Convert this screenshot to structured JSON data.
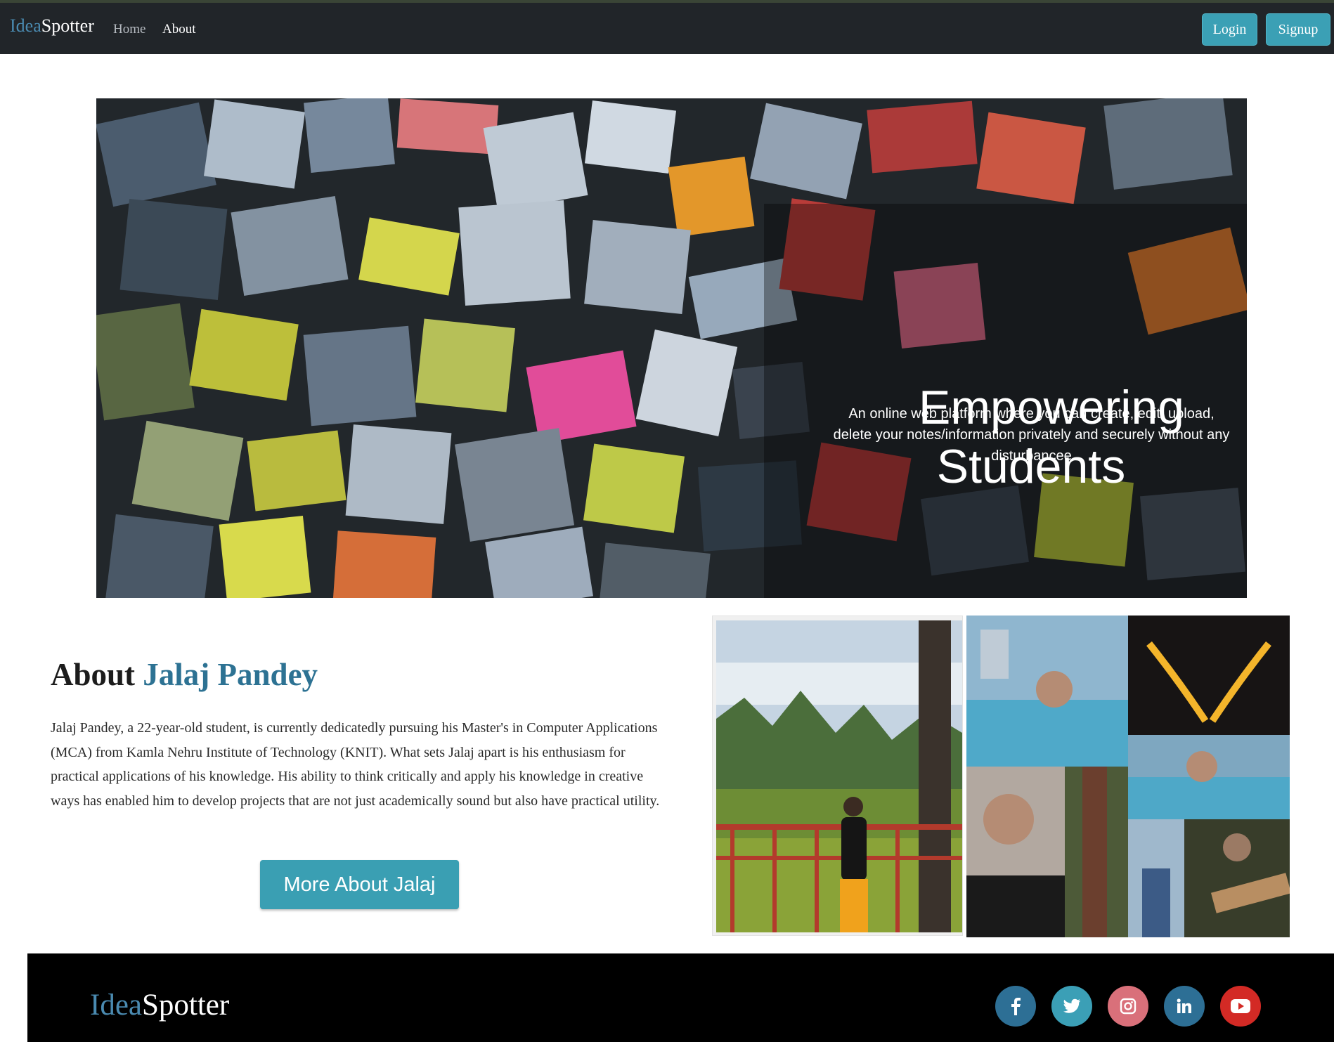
{
  "navbar": {
    "brand_part1": "Idea",
    "brand_part2": "Spotter",
    "links": [
      "Home",
      "About"
    ],
    "login_label": "Login",
    "signup_label": "Signup"
  },
  "hero": {
    "title_line1": "Empowering",
    "title_line2": "Students",
    "subtitle": "An online web platform where you can create, edit, upload, delete your notes/information privately and securely without any disturbancee"
  },
  "about": {
    "heading_prefix": "About",
    "heading_name": "Jalaj Pandey",
    "paragraph": "Jalaj Pandey, a 22-year-old student, is currently dedicatedly pursuing his Master's in Computer Applications (MCA) from Kamla Nehru Institute of Technology (KNIT). What sets Jalaj apart is his enthusiasm for practical applications of his knowledge. His ability to think critically and apply his knowledge in creative ways has enabled him to develop projects that are not just academically sound but also have practical utility.",
    "more_button": "More About Jalaj"
  },
  "footer": {
    "brand_part1": "Idea",
    "brand_part2": "Spotter",
    "social": [
      {
        "name": "facebook-icon",
        "glyph": "f",
        "color": "#2d6f95"
      },
      {
        "name": "twitter-icon",
        "glyph": "t",
        "color": "#3b9fb6"
      },
      {
        "name": "instagram-icon",
        "glyph": "◎",
        "color": "#d9707a"
      },
      {
        "name": "linkedin-icon",
        "glyph": "in",
        "color": "#2d6f95"
      },
      {
        "name": "youtube-icon",
        "glyph": "▶",
        "color": "#d32a25"
      }
    ]
  },
  "colors": {
    "navbar_bg": "#212529",
    "accent_blue": "#2d7293",
    "button_teal": "#3ba0b5",
    "footer_bg": "#000000"
  }
}
